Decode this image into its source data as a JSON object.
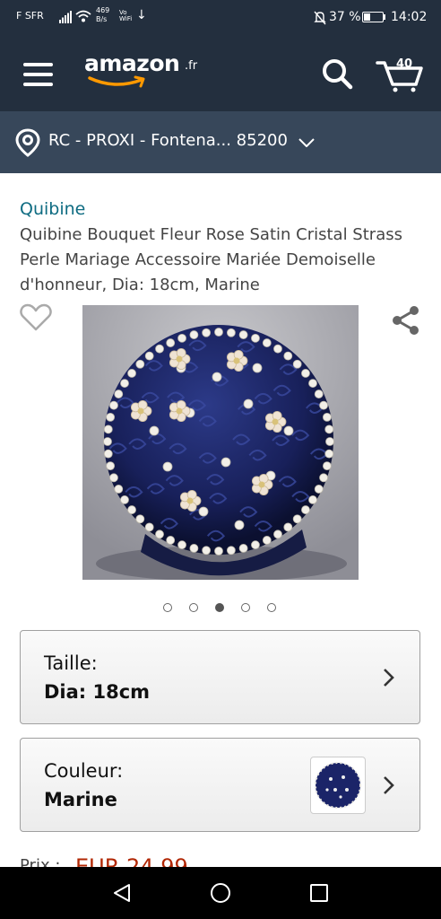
{
  "status_bar": {
    "carrier": "F SFR",
    "net_speed_value": "469",
    "net_speed_unit": "B/s",
    "vowifi_top": "Vo",
    "vowifi_bottom": "WiFi",
    "battery_percent": "37 %",
    "battery_level": 0.37,
    "time": "14:02"
  },
  "header": {
    "logo_word": "amazon",
    "logo_tld": ".fr",
    "cart_count": "40",
    "icons": {
      "menu": "hamburger-icon",
      "search": "search-icon",
      "cart": "cart-icon"
    }
  },
  "location": {
    "text": "RC - PROXI - Fontena... 85200",
    "icon": "location-pin-icon"
  },
  "product": {
    "brand": "Quibine",
    "title": "Quibine Bouquet Fleur Rose Satin Cristal Strass Perle Mariage Accessoire Mariée Demoiselle d'honneur, Dia: 18cm, Marine",
    "image_count": 5,
    "active_image_index": 2
  },
  "options": {
    "size": {
      "label": "Taille:",
      "value": "Dia: 18cm"
    },
    "color": {
      "label": "Couleur:",
      "value": "Marine"
    }
  },
  "price": {
    "label": "Prix :",
    "value": "EUR 24,99"
  },
  "colors": {
    "header_bg": "#232f3e",
    "location_bg": "#37475a",
    "brand_link": "#0f6c82",
    "price": "#b12704",
    "smile": "#f90"
  }
}
